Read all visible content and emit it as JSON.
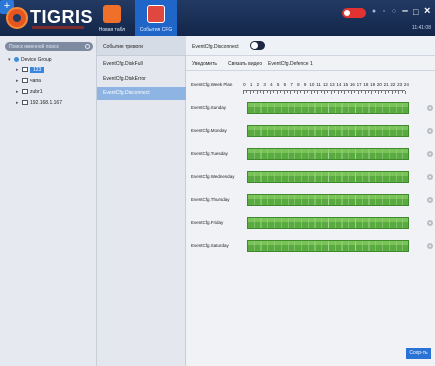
{
  "app": {
    "logo_text": "TIGRIS",
    "clock": "11:41:08"
  },
  "toolbar": {
    "home_label": "Новая табл",
    "config_label": "События СFG",
    "add_label": "+"
  },
  "colors": {
    "titlebar": "#1b2f55",
    "accent": "#2b72d6",
    "schedule_green": "#5aab3f",
    "record": "#e33232"
  },
  "left_panel": {
    "search_placeholder": "Поиск именной поиск",
    "tree": [
      {
        "label": "Device Group",
        "level": 0,
        "type": "group"
      },
      {
        "label": "123",
        "level": 1,
        "type": "device",
        "selected": true
      },
      {
        "label": "чапа",
        "level": 1,
        "type": "device"
      },
      {
        "label": "zubr1",
        "level": 1,
        "type": "device"
      },
      {
        "label": "192.168.1.167",
        "level": 1,
        "type": "device"
      }
    ]
  },
  "middle_panel": {
    "header": "Событие тревоги",
    "events": [
      {
        "label": "EventCfg.DiskFull",
        "selected": false
      },
      {
        "label": "EventCfg.DiskError",
        "selected": false
      },
      {
        "label": "EventCfg.Disconnect",
        "selected": true
      }
    ]
  },
  "right_panel": {
    "enable_label": "EventCfg.Disconnect",
    "enable_on": false,
    "tabs": [
      "Уведомить",
      "Связать видео",
      "EventCfg.Defence 1"
    ],
    "week_plan_label": "EventCfg.Week Plan",
    "hours": [
      "0",
      "1",
      "2",
      "3",
      "4",
      "5",
      "6",
      "7",
      "8",
      "9",
      "10",
      "11",
      "12",
      "13",
      "14",
      "15",
      "16",
      "17",
      "18",
      "19",
      "20",
      "21",
      "22",
      "23",
      "24"
    ],
    "days": [
      "EventCfg.Sunday",
      "EventCfg.Monday",
      "EventCfg.Tuesday",
      "EventCfg.Wednesday",
      "EventCfg.Thursday",
      "EventCfg.Friday",
      "EventCfg.Saturday"
    ],
    "save_label": "Сохр-ть"
  }
}
